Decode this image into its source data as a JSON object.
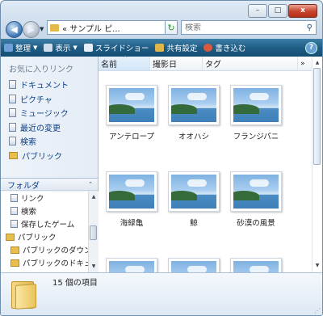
{
  "window": {
    "caption_buttons": [
      {
        "name": "minimize-button",
        "glyph": "–"
      },
      {
        "name": "maximize-button",
        "glyph": "□"
      },
      {
        "name": "close-button",
        "glyph": "x"
      }
    ]
  },
  "nav": {
    "back_glyph": "◀",
    "forward_glyph": "▶",
    "address_text": "«  サンプル ピ...",
    "refresh_glyph": "↻",
    "search_placeholder": "検索",
    "search_glyph": "⚲"
  },
  "toolbar": {
    "items": [
      {
        "label": "整理",
        "has_arrow": true,
        "icon": "organize-icon",
        "color": "#6fa0d8"
      },
      {
        "label": "表示",
        "has_arrow": true,
        "icon": "views-icon",
        "color": "#cfdcec"
      },
      {
        "label": "スライドショー",
        "has_arrow": false,
        "icon": "slideshow-icon",
        "color": "#e6eef8"
      },
      {
        "label": "共有設定",
        "has_arrow": false,
        "icon": "share-icon",
        "color": "#e0b64a"
      },
      {
        "label": "書き込む",
        "has_arrow": false,
        "icon": "burn-icon",
        "color": "#d8593c"
      }
    ],
    "help_glyph": "?"
  },
  "sidebar": {
    "favorites_title": "お気に入りリンク",
    "favorites": [
      {
        "label": "ドキュメント",
        "icon": "document-icon"
      },
      {
        "label": "ピクチャ",
        "icon": "picture-icon"
      },
      {
        "label": "ミュージック",
        "icon": "music-icon"
      },
      {
        "label": "最近の変更",
        "icon": "recent-icon"
      },
      {
        "label": "検索",
        "icon": "search-icon"
      },
      {
        "label": "パブリック",
        "icon": "folder-icon"
      }
    ],
    "folders_label": "フォルダ",
    "folders_chevron": "⌃",
    "tree": [
      {
        "label": "リンク",
        "indent": 1,
        "icon": "link-icon"
      },
      {
        "label": "検索",
        "indent": 1,
        "icon": "search-icon"
      },
      {
        "label": "保存したゲーム",
        "indent": 1,
        "icon": "games-icon"
      },
      {
        "label": "パブリック",
        "indent": 0,
        "icon": "folder-icon"
      },
      {
        "label": "パブリックのダウン",
        "indent": 1,
        "icon": "folder-icon"
      },
      {
        "label": "パブリックのドキュ",
        "indent": 1,
        "icon": "folder-icon"
      }
    ]
  },
  "content": {
    "columns": [
      {
        "label": "名前",
        "key": "name"
      },
      {
        "label": "撮影日",
        "key": "date"
      },
      {
        "label": "タグ",
        "key": "tag"
      },
      {
        "label": "»",
        "key": "more"
      }
    ],
    "sort_glyph": "^",
    "items": [
      "アンテロープ",
      "オオハシ",
      "フランジパニ",
      "海緑亀",
      "鯨",
      "砂漠の風景",
      "",
      "",
      ""
    ]
  },
  "details": {
    "count_text": "15 個の項目",
    "resize_glyph": "⋰"
  }
}
